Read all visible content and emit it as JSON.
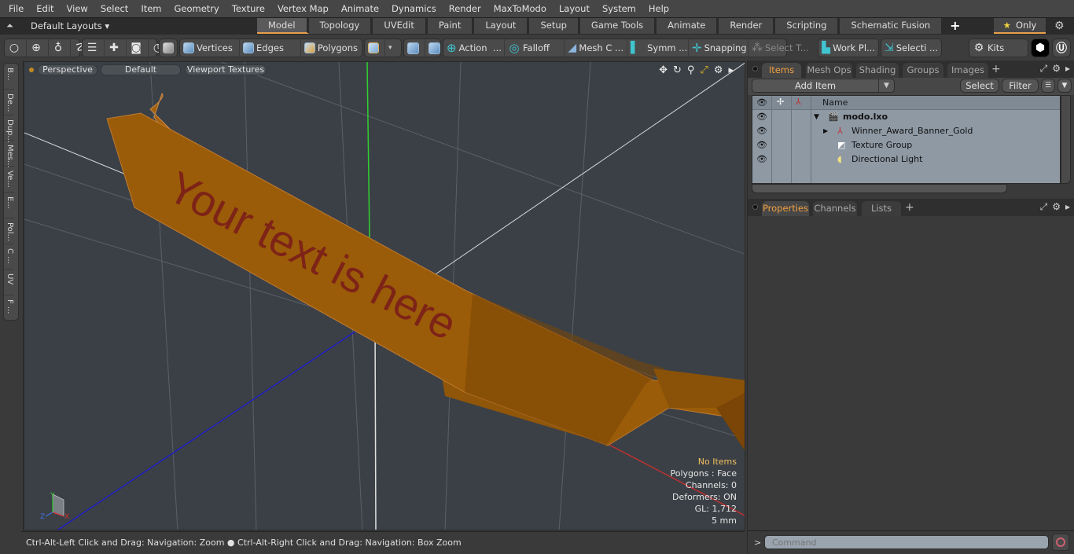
{
  "menu": [
    "File",
    "Edit",
    "View",
    "Select",
    "Item",
    "Geometry",
    "Texture",
    "Vertex Map",
    "Animate",
    "Dynamics",
    "Render",
    "MaxToModo",
    "Layout",
    "System",
    "Help"
  ],
  "layoutbar": {
    "layouts_label": "Default Layouts",
    "tabs": [
      "Model",
      "Topology",
      "UVEdit",
      "Paint",
      "Layout",
      "Setup",
      "Game Tools",
      "Animate",
      "Render",
      "Scripting",
      "Schematic Fusion"
    ],
    "active_tab": "Model",
    "only_label": "Only"
  },
  "toolbar": {
    "vertices": "Vertices",
    "edges": "Edges",
    "polygons": "Polygons",
    "action": "Action",
    "action_more": "...",
    "falloff": "Falloff",
    "mesh_c": "Mesh C ...",
    "symm": "Symm ...",
    "snapping": "Snapping",
    "select_t": "Select T...",
    "work_pl": "Work Pl...",
    "selecti": "Selecti ...",
    "kits": "Kits"
  },
  "left_tabs": [
    "B...",
    "De...",
    "Dup...",
    "Mes...",
    "Ve...",
    "E...",
    "Pol...",
    "C ...",
    "UV",
    "F ..."
  ],
  "viewport": {
    "view_mode": "Perspective",
    "shading": "Default",
    "texture_mode": "Viewport Textures",
    "banner_text": "Your text is here",
    "info": {
      "selection": "No Items",
      "polygons": "Polygons : Face",
      "channels": "Channels: 0",
      "deformers": "Deformers: ON",
      "gl": "GL: 1,712",
      "grid": "5 mm"
    },
    "axis_labels": {
      "x": "X",
      "y": "Y",
      "z": "Z"
    },
    "colors": {
      "banner": "#9a5c08",
      "banner_text": "#7a1a1a",
      "x_axis": "#c03030",
      "y_axis": "#30d030",
      "z_axis": "#2020c0",
      "background": "#3b4046"
    }
  },
  "status": {
    "hint_left": "Ctrl-Alt-Left Click and Drag: Navigation: Zoom",
    "hint_right": "Ctrl-Alt-Right Click and Drag: Navigation: Box Zoom"
  },
  "items_panel": {
    "tabs": [
      "Items",
      "Mesh Ops",
      "Shading",
      "Groups",
      "Images"
    ],
    "active_tab": "Items",
    "add_item": "Add Item",
    "select": "Select",
    "filter": "Filter",
    "name_header": "Name",
    "tree": [
      {
        "label": "modo.lxo",
        "bold": true,
        "icon": "scene-icon"
      },
      {
        "label": "Winner_Award_Banner_Gold",
        "bold": false,
        "icon": "mesh-locator-icon"
      },
      {
        "label": "Texture Group",
        "bold": false,
        "icon": "texture-group-icon"
      },
      {
        "label": "Directional Light",
        "bold": false,
        "icon": "light-icon"
      }
    ]
  },
  "properties_panel": {
    "tabs": [
      "Properties",
      "Channels",
      "Lists"
    ],
    "active_tab": "Properties"
  },
  "command": {
    "prompt": ">",
    "placeholder": "Command"
  }
}
